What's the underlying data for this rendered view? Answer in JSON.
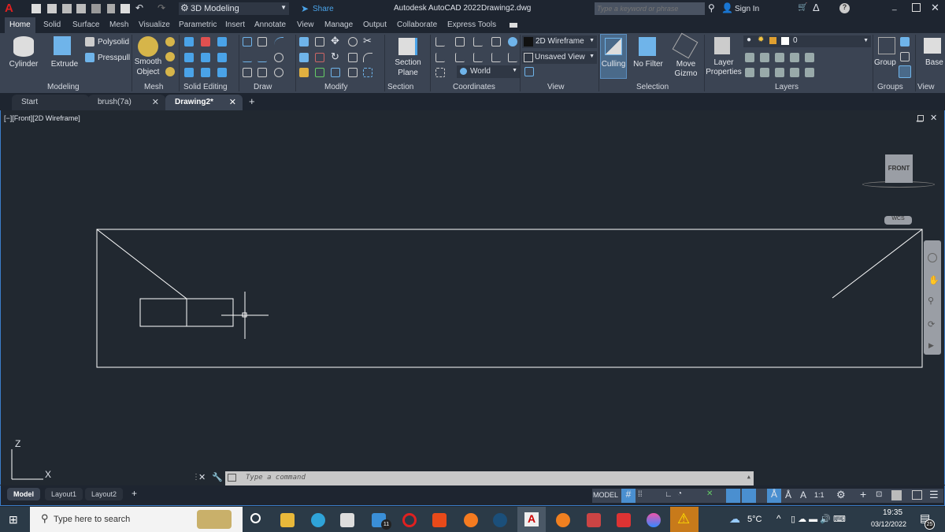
{
  "titlebar": {
    "workspace": "3D Modeling",
    "share": "Share",
    "title": "Autodesk AutoCAD 2022",
    "file": "Drawing2.dwg",
    "search_placeholder": "Type a keyword or phrase",
    "signin": "Sign In"
  },
  "ribbon_tabs": [
    "Home",
    "Solid",
    "Surface",
    "Mesh",
    "Visualize",
    "Parametric",
    "Insert",
    "Annotate",
    "View",
    "Manage",
    "Output",
    "Collaborate",
    "Express Tools"
  ],
  "ribbon": {
    "modeling": {
      "label": "Modeling",
      "cylinder": "Cylinder",
      "extrude": "Extrude",
      "polysolid": "Polysolid",
      "presspull": "Presspull"
    },
    "mesh": {
      "label": "Mesh",
      "smooth1": "Smooth",
      "smooth2": "Object"
    },
    "solid_editing": {
      "label": "Solid Editing"
    },
    "draw": {
      "label": "Draw"
    },
    "modify": {
      "label": "Modify"
    },
    "section": {
      "label": "Section",
      "btn1": "Section",
      "btn2": "Plane"
    },
    "coordinates": {
      "label": "Coordinates",
      "ucs": "World"
    },
    "view": {
      "label": "View",
      "visual_style": "2D Wireframe",
      "named_view": "Unsaved View"
    },
    "selection": {
      "label": "Selection",
      "culling": "Culling",
      "filter": "No Filter",
      "gizmo1": "Move",
      "gizmo2": "Gizmo"
    },
    "layers": {
      "label": "Layers",
      "props1": "Layer",
      "props2": "Properties",
      "current_layer": "0"
    },
    "groups": {
      "label": "Groups",
      "group": "Group"
    },
    "view2": {
      "label": "View",
      "base": "Base"
    }
  },
  "file_tabs": [
    {
      "label": "Start"
    },
    {
      "label": "brush(7a)"
    },
    {
      "label": "Drawing2*"
    }
  ],
  "viewport": {
    "label": "[−][Front][2D Wireframe]",
    "viewcube": "FRONT",
    "wcs": "WCS",
    "axis_y": "Z",
    "axis_x": "X"
  },
  "command": {
    "placeholder": "Type a command"
  },
  "layout_tabs": [
    "Model",
    "Layout1",
    "Layout2"
  ],
  "status": {
    "model": "MODEL",
    "scale": "1:1"
  },
  "taskbar": {
    "search": "Type here to search",
    "temp": "5°C",
    "time": "19:35",
    "date": "03/12/2022",
    "mail_badge": "11",
    "notif_badge": "25"
  }
}
